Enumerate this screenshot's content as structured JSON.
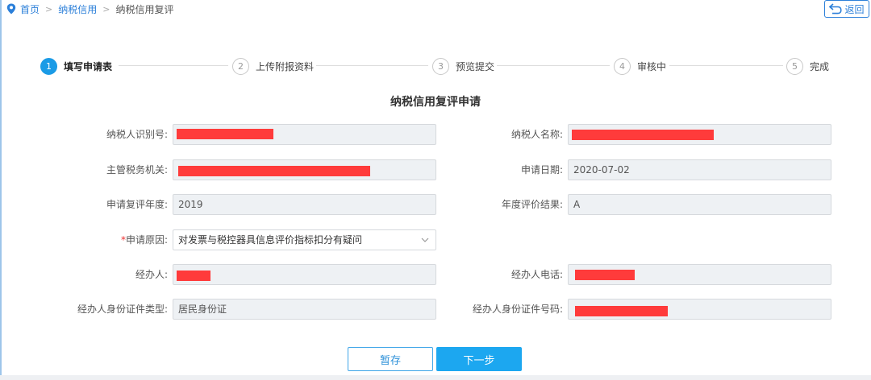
{
  "breadcrumb": {
    "home": "首页",
    "section": "纳税信用",
    "current": "纳税信用复评",
    "separator": ">"
  },
  "back_label": "返回",
  "steps": [
    {
      "num": "1",
      "label": "填写申请表",
      "active": true
    },
    {
      "num": "2",
      "label": "上传附报资料",
      "active": false
    },
    {
      "num": "3",
      "label": "预览提交",
      "active": false
    },
    {
      "num": "4",
      "label": "审核中",
      "active": false
    },
    {
      "num": "5",
      "label": "完成",
      "active": false
    }
  ],
  "form": {
    "title": "纳税信用复评申请",
    "taxpayer_id": {
      "label": "纳税人识别号:",
      "value": ""
    },
    "taxpayer_name": {
      "label": "纳税人名称:",
      "value": ""
    },
    "tax_authority": {
      "label": "主管税务机关:",
      "value": ""
    },
    "apply_date": {
      "label": "申请日期:",
      "value": "2020-07-02"
    },
    "review_year": {
      "label": "申请复评年度:",
      "value": "2019"
    },
    "annual_result": {
      "label": "年度评价结果:",
      "value": "A"
    },
    "reason": {
      "required_mark": "*",
      "label": "申请原因:",
      "value": "对发票与税控器具信息评价指标扣分有疑问"
    },
    "agent": {
      "label": "经办人:",
      "value": ""
    },
    "agent_phone": {
      "label": "经办人电话:",
      "value": ""
    },
    "id_type": {
      "label": "经办人身份证件类型:",
      "value": "居民身份证"
    },
    "id_number": {
      "label": "经办人身份证件号码:",
      "value": ""
    }
  },
  "buttons": {
    "save": "暂存",
    "next": "下一步"
  },
  "colors": {
    "accent": "#1ca7f0",
    "redaction": "#ff3b3b",
    "link": "#2b7fd9"
  }
}
